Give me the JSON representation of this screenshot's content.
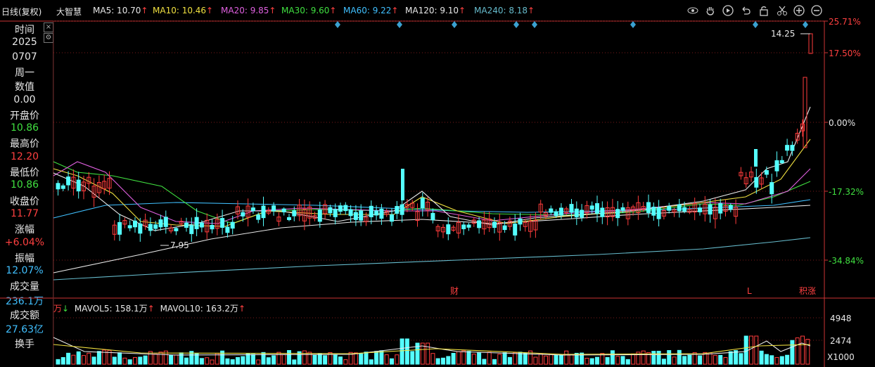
{
  "header": {
    "period": "日线(复权)",
    "stock_name": "大智慧",
    "ma": [
      {
        "label": "MA5: 10.70",
        "color": "#e8e8e8"
      },
      {
        "label": "MA10: 10.46",
        "color": "#f0e040"
      },
      {
        "label": "MA20: 9.85",
        "color": "#e060e0"
      },
      {
        "label": "MA30: 9.60",
        "color": "#40e040"
      },
      {
        "label": "MA60: 9.22",
        "color": "#40c0ff"
      },
      {
        "label": "MA120: 9.10",
        "color": "#e8e8e8"
      },
      {
        "label": "MA240: 8.18",
        "color": "#66bbcc"
      }
    ],
    "arrow": "↑",
    "toolbar_icons": [
      "eye-icon",
      "hand-icon",
      "play-icon",
      "undo-icon",
      "lock-icon",
      "scissors-icon",
      "zoom-in-icon",
      "zoom-out-icon"
    ]
  },
  "info_panel": {
    "rows": [
      {
        "label": "时间"
      },
      {
        "value": "2025",
        "color": "#e8e8e8"
      },
      {
        "value": "0707",
        "color": "#e8e8e8"
      },
      {
        "value": "周一",
        "color": "#e8e8e8"
      },
      {
        "label": "数值"
      },
      {
        "value": "0.00",
        "color": "#e8e8e8"
      },
      {
        "label": "开盘价"
      },
      {
        "value": "10.86",
        "color": "#40e040"
      },
      {
        "label": "最高价"
      },
      {
        "value": "12.20",
        "color": "#ff4040"
      },
      {
        "label": "最低价"
      },
      {
        "value": "10.86",
        "color": "#40e040"
      },
      {
        "label": "收盘价"
      },
      {
        "value": "11.77",
        "color": "#ff4040"
      },
      {
        "label": "涨幅"
      },
      {
        "value": "+6.04%",
        "color": "#ff4040"
      },
      {
        "label": "振幅"
      },
      {
        "value": "12.07%",
        "color": "#40c0ff"
      },
      {
        "label": "成交量"
      },
      {
        "value": "236.1万",
        "color": "#40c0ff"
      },
      {
        "label": "成交额"
      },
      {
        "value": "27.63亿",
        "color": "#40c0ff"
      },
      {
        "label": "换手"
      }
    ]
  },
  "price_axis": {
    "labels": [
      "25.71%",
      "17.50%",
      "0.00%",
      "-17.32%",
      "-34.84%"
    ]
  },
  "annotations": {
    "high_label": "14.25",
    "low_label": "7.95",
    "markers": [
      "财",
      "L",
      "积涨"
    ]
  },
  "volume": {
    "unit": "万",
    "mavol5": "MAVOL5: 158.1万",
    "mavol10": "MAVOL10: 163.2万",
    "axis_labels": [
      "4948",
      "2474",
      "X1000"
    ]
  },
  "colors": {
    "up": "#ff3c3c",
    "down": "#54ffff",
    "grid": "#7a1a1a",
    "axis": "#cc3333"
  }
}
